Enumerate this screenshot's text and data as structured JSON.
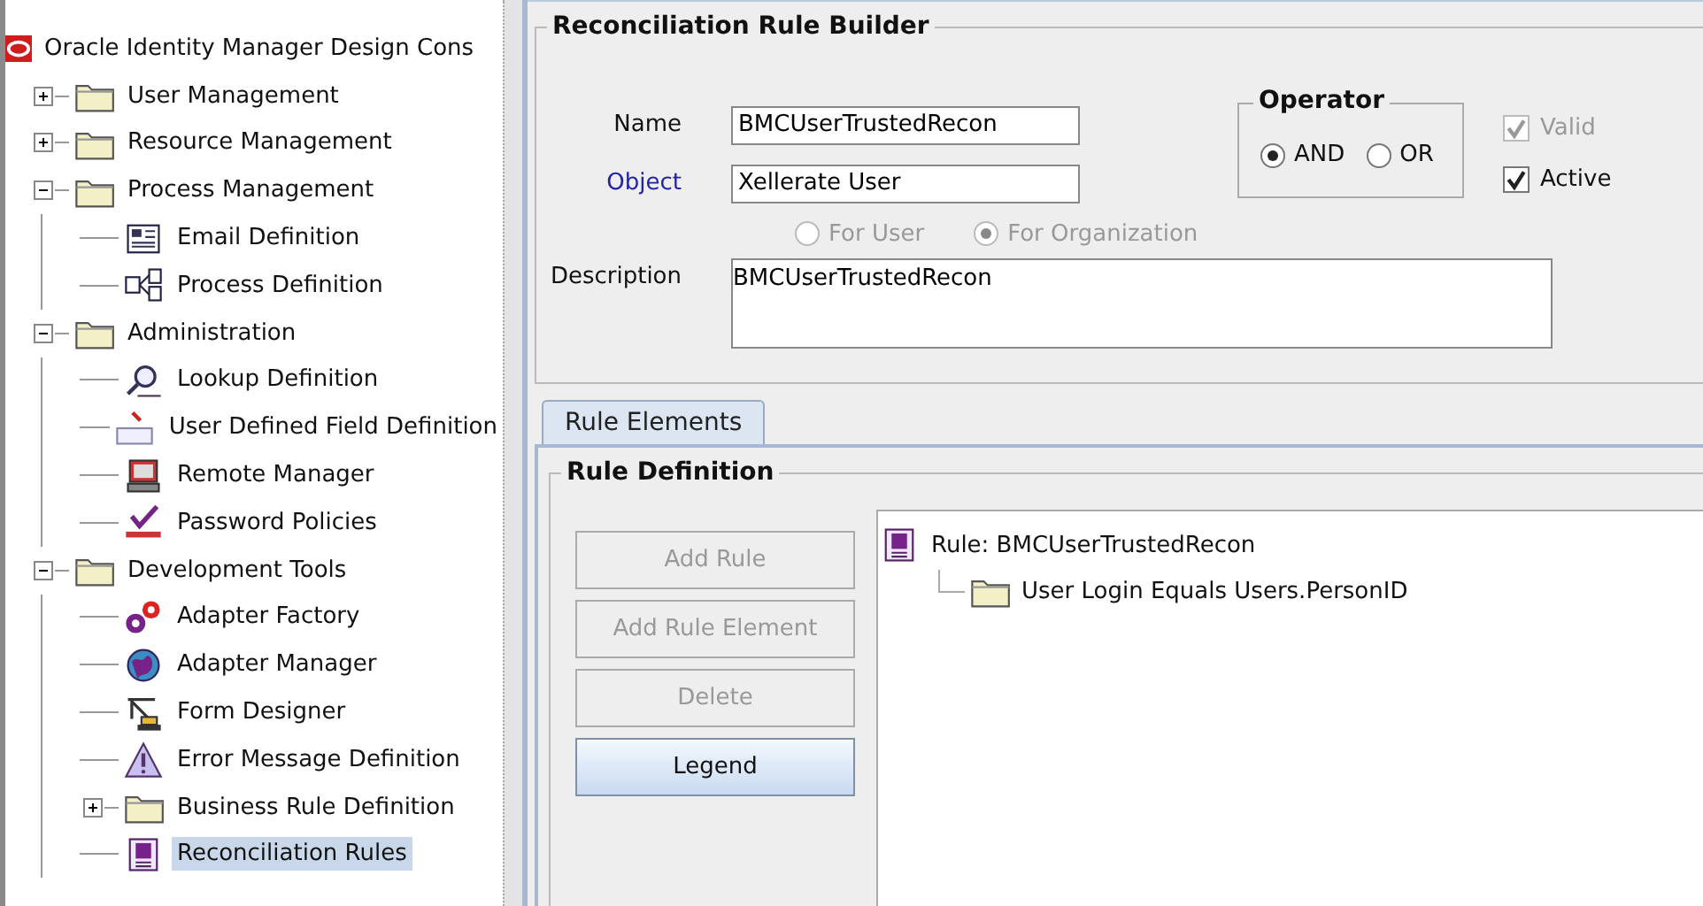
{
  "navigator": {
    "root": {
      "title": "Oracle Identity Manager Design Cons"
    },
    "items": [
      {
        "label": "User Management",
        "kind": "folder",
        "expanded": false,
        "selected": false
      },
      {
        "label": "Resource Management",
        "kind": "folder",
        "expanded": false,
        "selected": false
      },
      {
        "label": "Process Management",
        "kind": "folder",
        "expanded": true,
        "selected": false,
        "children": [
          {
            "label": "Email Definition",
            "kind": "email",
            "selected": false
          },
          {
            "label": "Process Definition",
            "kind": "process",
            "selected": false
          }
        ]
      },
      {
        "label": "Administration",
        "kind": "folder",
        "expanded": true,
        "selected": false,
        "children": [
          {
            "label": "Lookup Definition",
            "kind": "lookup",
            "selected": false
          },
          {
            "label": "User Defined Field Definition",
            "kind": "field",
            "selected": false
          },
          {
            "label": "Remote Manager",
            "kind": "remote",
            "selected": false
          },
          {
            "label": "Password Policies",
            "kind": "password",
            "selected": false
          }
        ]
      },
      {
        "label": "Development Tools",
        "kind": "folder",
        "expanded": true,
        "selected": false,
        "children": [
          {
            "label": "Adapter Factory",
            "kind": "gears",
            "selected": false
          },
          {
            "label": "Adapter Manager",
            "kind": "globe",
            "selected": false
          },
          {
            "label": "Form Designer",
            "kind": "crane",
            "selected": false
          },
          {
            "label": "Error Message Definition",
            "kind": "warning",
            "selected": false
          },
          {
            "label": "Business Rule Definition",
            "kind": "folder",
            "expanded": false,
            "selected": false
          },
          {
            "label": "Reconciliation Rules",
            "kind": "rule",
            "selected": true
          }
        ]
      }
    ]
  },
  "builder": {
    "title": "Reconciliation Rule Builder",
    "fields": [
      {
        "label": "Name",
        "value": "BMCUserTrustedRecon",
        "link": false
      },
      {
        "label": "Object",
        "value": "Xellerate User",
        "link": true
      }
    ],
    "scope": [
      {
        "label": "For User",
        "selected": false,
        "disabled": true
      },
      {
        "label": "For Organization",
        "selected": true,
        "disabled": true
      }
    ],
    "description": {
      "label": "Description",
      "value": "BMCUserTrustedRecon"
    },
    "operator": {
      "title": "Operator",
      "options": [
        {
          "label": "AND",
          "selected": true
        },
        {
          "label": "OR",
          "selected": false
        }
      ]
    },
    "flags": [
      {
        "label": "Valid",
        "checked": true,
        "disabled": true
      },
      {
        "label": "Active",
        "checked": true,
        "disabled": false
      }
    ]
  },
  "tabs": [
    {
      "label": "Rule Elements",
      "selected": true
    }
  ],
  "rule_definition": {
    "title": "Rule Definition",
    "buttons": [
      {
        "label": "Add Rule",
        "disabled": true
      },
      {
        "label": "Add Rule Element",
        "disabled": true
      },
      {
        "label": "Delete",
        "disabled": true
      },
      {
        "label": "Legend",
        "disabled": false
      }
    ],
    "tree": [
      {
        "label": "Rule: BMCUserTrustedRecon",
        "kind": "rule",
        "children": [
          {
            "label": "User Login Equals Users.PersonID",
            "kind": "folder"
          }
        ]
      }
    ]
  }
}
